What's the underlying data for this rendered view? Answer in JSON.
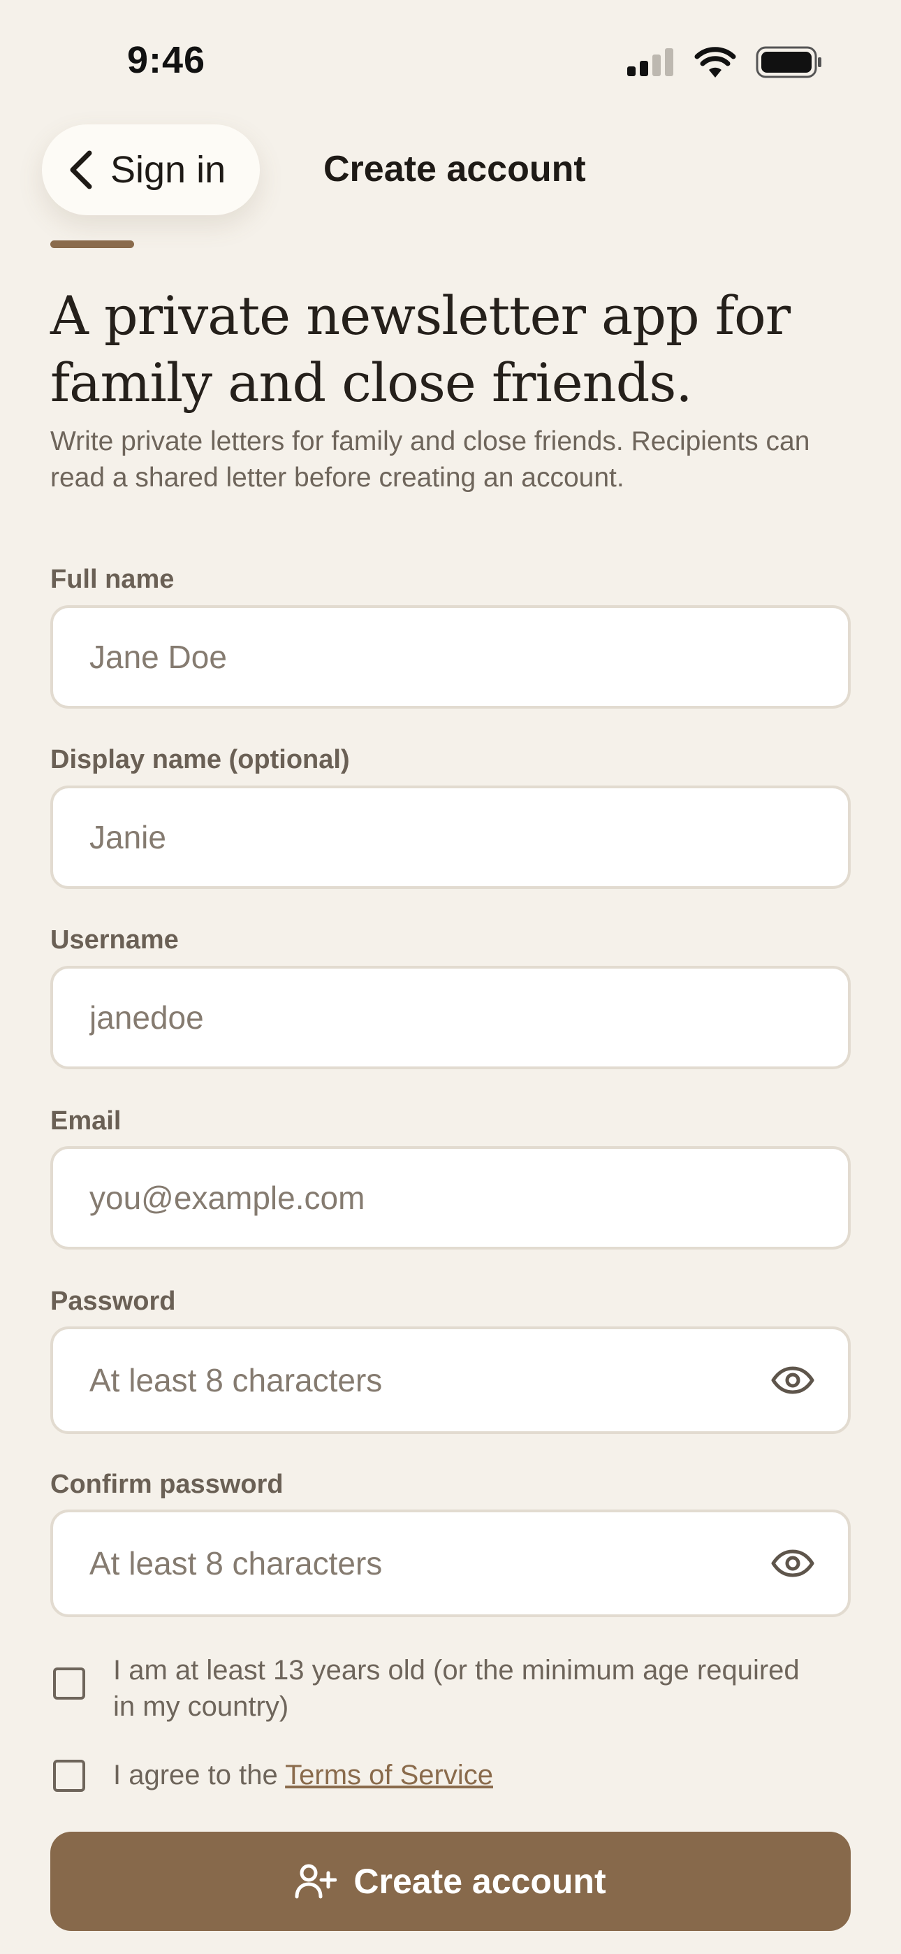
{
  "status_bar": {
    "time": "9:46"
  },
  "nav": {
    "back_label": "Sign in",
    "title": "Create account"
  },
  "hero": {
    "headline": "A private newsletter app for family and close friends.",
    "subtext": "Write private letters for family and close friends. Recipients can read a shared letter before creating an account."
  },
  "form": {
    "full_name": {
      "label": "Full name",
      "placeholder": "Jane Doe"
    },
    "display_name": {
      "label": "Display name (optional)",
      "placeholder": "Janie"
    },
    "username": {
      "label": "Username",
      "placeholder": "janedoe"
    },
    "email": {
      "label": "Email",
      "placeholder": "you@example.com"
    },
    "password": {
      "label": "Password",
      "placeholder": "At least 8 characters"
    },
    "confirm_password": {
      "label": "Confirm password",
      "placeholder": "At least 8 characters"
    },
    "age_check": {
      "text": "I am at least 13 years old (or the minimum age required in my country)",
      "checked": false
    },
    "terms_check": {
      "prefix": "I agree to the ",
      "link": "Terms of Service",
      "checked": false
    },
    "submit_label": "Create account"
  },
  "icons": {
    "back": "chevron-left-icon",
    "eye": "eye-icon",
    "add_user": "user-plus-icon",
    "signal": "cellular-signal-icon",
    "wifi": "wifi-icon",
    "battery": "battery-icon"
  },
  "colors": {
    "background": "#f5f1ea",
    "accent": "#87694b",
    "field_border": "#e2dbd0",
    "muted_text": "#6e655b"
  }
}
